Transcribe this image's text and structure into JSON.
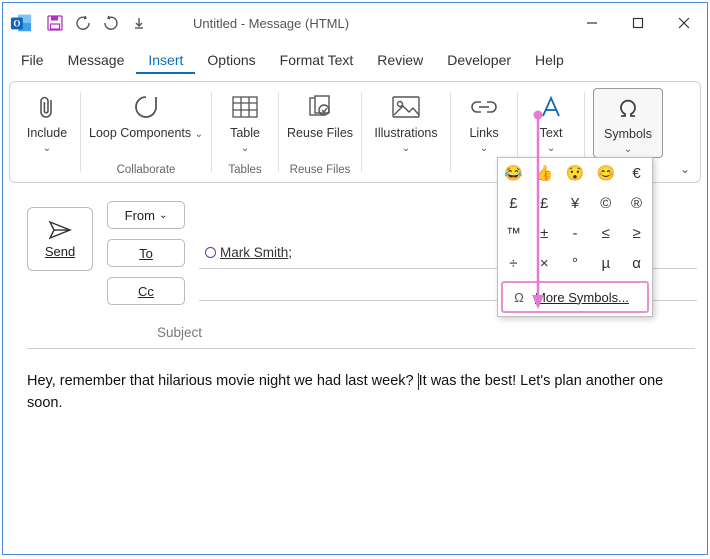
{
  "window": {
    "title": "Untitled  -  Message (HTML)"
  },
  "menu": {
    "file": "File",
    "message": "Message",
    "insert": "Insert",
    "options": "Options",
    "format_text": "Format Text",
    "review": "Review",
    "developer": "Developer",
    "help": "Help"
  },
  "ribbon": {
    "include": "Include",
    "loop": "Loop Components",
    "collaborate_caption": "Collaborate",
    "table": "Table",
    "tables_caption": "Tables",
    "reuse": "Reuse Files",
    "reuse_caption": "Reuse Files",
    "illustrations": "Illustrations",
    "links": "Links",
    "text": "Text",
    "symbols": "Symbols"
  },
  "symbols_grid": [
    "😂",
    "👍",
    "😯",
    "😊",
    "€",
    "£",
    "£",
    "¥",
    "©",
    "®",
    "™",
    "±",
    "-",
    "≤",
    "≥",
    "÷",
    "×",
    "°",
    "µ",
    "α"
  ],
  "symbols_more": "More Symbols...",
  "compose": {
    "send": "Send",
    "from": "From",
    "to": "To",
    "cc": "Cc",
    "recipient": "Mark Smith",
    "subject_placeholder": "Subject",
    "body": "Hey, remember that hilarious movie night we had last week? ",
    "body2": "It was the best! Let's plan another one soon."
  }
}
